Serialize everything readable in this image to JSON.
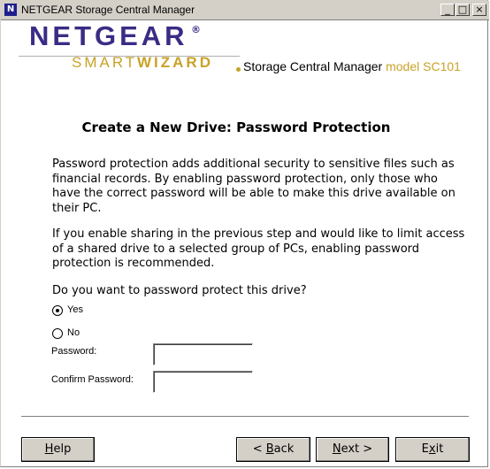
{
  "window": {
    "title": "NETGEAR Storage Central Manager",
    "controls": {
      "minimize": "_",
      "maximize": "□",
      "close": "×"
    }
  },
  "branding": {
    "logo_main": "NETGEAR",
    "logo_reg": "®",
    "logo_smart": "SMART",
    "logo_wizard": "WIZARD",
    "product_name": "Storage Central Manager",
    "product_model": "model SC101",
    "colors": {
      "logo_purple": "#3a2c85",
      "logo_gold": "#c9a227"
    }
  },
  "content": {
    "heading": "Create a New Drive: Password Protection",
    "paragraph1": "Password protection adds additional security to sensitive files such as financial records. By enabling password protection, only those who have the correct password will be able to make this drive available on their PC.",
    "paragraph2": "If you enable sharing in the previous step and would like to limit access of a shared drive to a selected group of PCs, enabling password protection is recommended.",
    "question": "Do you want to password protect this drive?",
    "options": [
      {
        "label": "Yes",
        "selected": true
      },
      {
        "label": "No",
        "selected": false
      }
    ],
    "password_label": "Password:",
    "password_value": "",
    "confirm_label": "Confirm Password:",
    "confirm_value": ""
  },
  "buttons": {
    "help": {
      "pre": "",
      "u": "H",
      "post": "elp"
    },
    "back": {
      "pre": "< ",
      "u": "B",
      "post": "ack"
    },
    "next": {
      "pre": "",
      "u": "N",
      "post": "ext >"
    },
    "exit": {
      "pre": "E",
      "u": "x",
      "post": "it"
    }
  }
}
